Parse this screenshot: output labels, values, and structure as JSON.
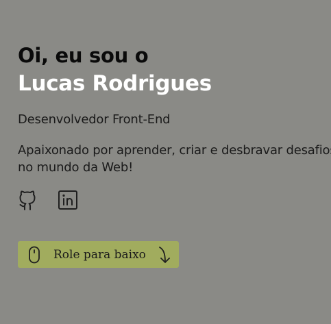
{
  "hero": {
    "greeting": "Oi, eu sou o",
    "name": "Lucas Rodrigues",
    "role": "Desenvolvedor Front-End",
    "bio_line1": "Apaixonado por aprender, criar e desbravar desafios",
    "bio_line2": "no mundo da Web!"
  },
  "socials": [
    {
      "icon": "github-icon"
    },
    {
      "icon": "linkedin-icon"
    }
  ],
  "scroll_button": {
    "label": "Role para baixo",
    "icon": "mouse-icon",
    "arrow_icon": "arrow-down-right-curved-icon"
  },
  "colors": {
    "background": "#8a8a86",
    "name": "#ffffff",
    "accent": "#a1ac5e",
    "text": "#1a1a1a"
  }
}
